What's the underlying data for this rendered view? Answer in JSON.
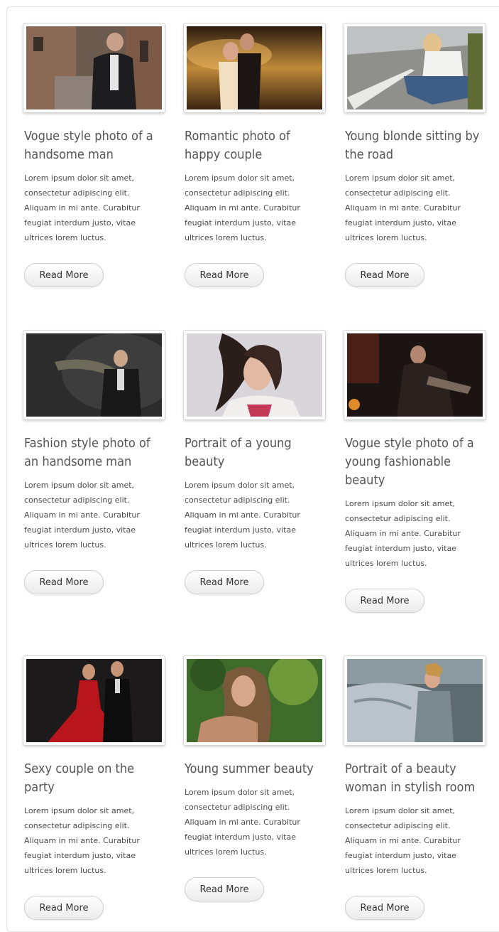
{
  "button_label": "Read More",
  "description": "Lorem ipsum dolor sit amet, consectetur adipiscing elit. Aliquam in mi ante. Curabitur feugiat interdum justo, vitae ultrices lorem luctus.",
  "posts": [
    {
      "title": "Vogue style photo of a handsome man"
    },
    {
      "title": "Romantic photo of happy couple"
    },
    {
      "title": "Young blonde sitting by the road"
    },
    {
      "title": "Fashion style photo of an handsome man"
    },
    {
      "title": "Portrait of a young beauty"
    },
    {
      "title": "Vogue style photo of a young fashionable beauty"
    },
    {
      "title": "Sexy couple on the party"
    },
    {
      "title": "Young summer beauty"
    },
    {
      "title": "Portrait of a beauty woman in stylish room"
    }
  ]
}
